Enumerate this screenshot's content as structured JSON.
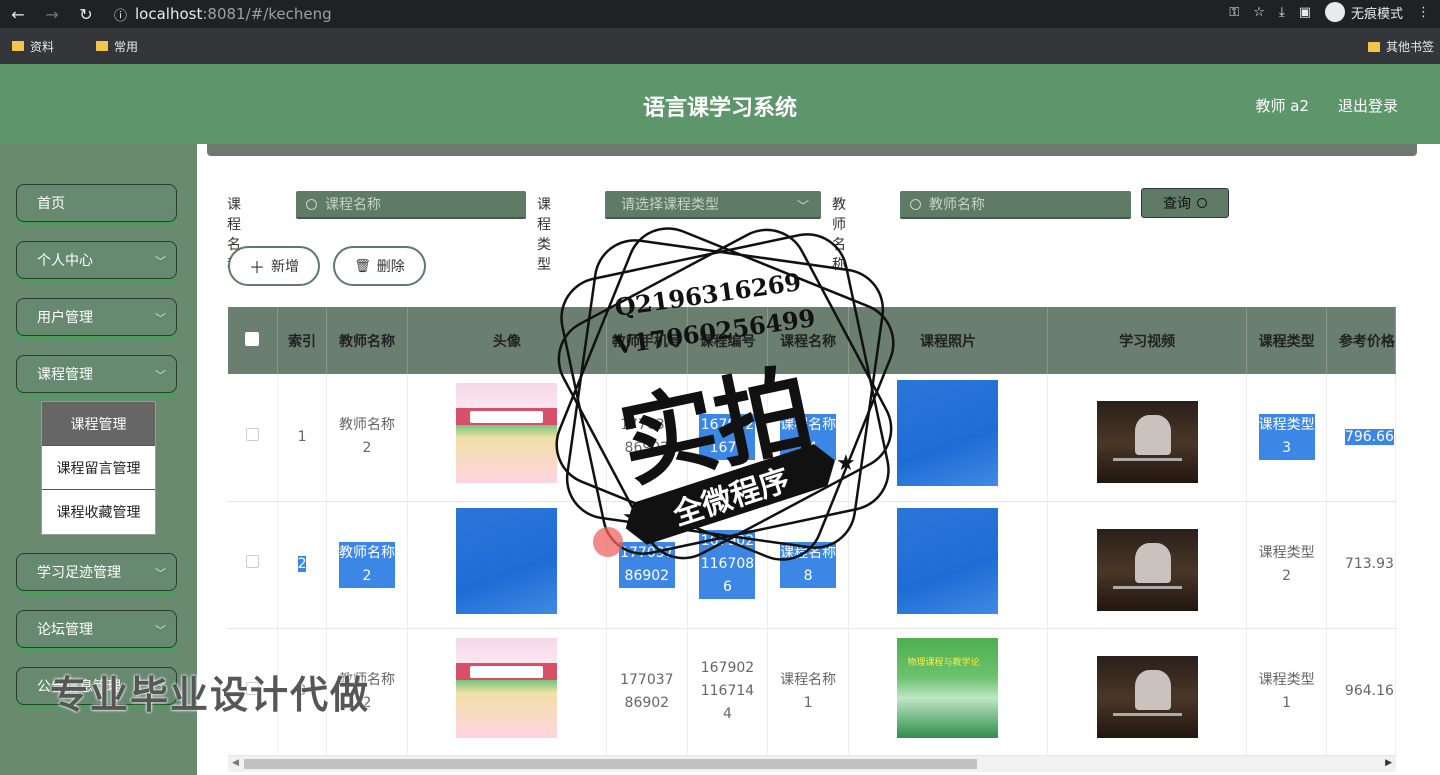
{
  "browser": {
    "url_host": "localhost",
    "url_rest": ":8081/#/kecheng",
    "incognito_label": "无痕模式",
    "bookmarks": [
      "资料",
      "常用"
    ],
    "bookmarks_right": "其他书签"
  },
  "header": {
    "title": "语言课学习系统",
    "user": "教师 a2",
    "logout": "退出登录"
  },
  "sidebar": {
    "items": [
      {
        "label": "首页",
        "has_chevron": false
      },
      {
        "label": "个人中心",
        "has_chevron": true
      },
      {
        "label": "用户管理",
        "has_chevron": true
      },
      {
        "label": "课程管理",
        "has_chevron": true
      },
      {
        "label": "学习足迹管理",
        "has_chevron": true
      },
      {
        "label": "论坛管理",
        "has_chevron": true
      },
      {
        "label": "公告信息管理",
        "has_chevron": true
      }
    ],
    "submenu": [
      "课程管理",
      "课程留言管理",
      "课程收藏管理"
    ]
  },
  "search": {
    "course_name_label": "课程名称",
    "course_name_placeholder": "课程名称",
    "course_type_label": "课程类型",
    "course_type_placeholder": "请选择课程类型",
    "teacher_name_label": "教师名称",
    "teacher_name_placeholder": "教师名称",
    "query_button": "查询"
  },
  "actions": {
    "add": "新增",
    "delete": "删除"
  },
  "table": {
    "columns": [
      "索引",
      "教师名称",
      "头像",
      "教师手机号",
      "课程编号",
      "课程名称",
      "课程照片",
      "学习视频",
      "课程类型",
      "参考价格"
    ],
    "rows": [
      {
        "index": "1",
        "teacher": "教师名称2",
        "phone": "17703786902",
        "course_no": "1679021671",
        "course_name": "课程名称14",
        "type": "课程类型3",
        "price": "796.66"
      },
      {
        "index": "2",
        "teacher": "教师名称2",
        "phone": "17703786902",
        "course_no": "1679021167086",
        "course_name": "课程名称8",
        "type": "课程类型2",
        "price": "713.93"
      },
      {
        "index": "3",
        "teacher": "教师名称2",
        "phone": "17703786902",
        "course_no": "1679021167144",
        "course_name": "课程名称1",
        "type": "课程类型1",
        "price": "964.16"
      }
    ]
  },
  "overlay": {
    "stamp_line1": "Q2196316269",
    "stamp_line2": "V17060256499",
    "stamp_big": "实拍",
    "stamp_banner": "全微程序",
    "watermark": "专业毕业设计代做"
  },
  "colors": {
    "header_green": "#5e966b",
    "sidebar_green": "#6a8a6f",
    "table_header": "#6b7f70",
    "highlight_blue": "#3c87e6"
  }
}
